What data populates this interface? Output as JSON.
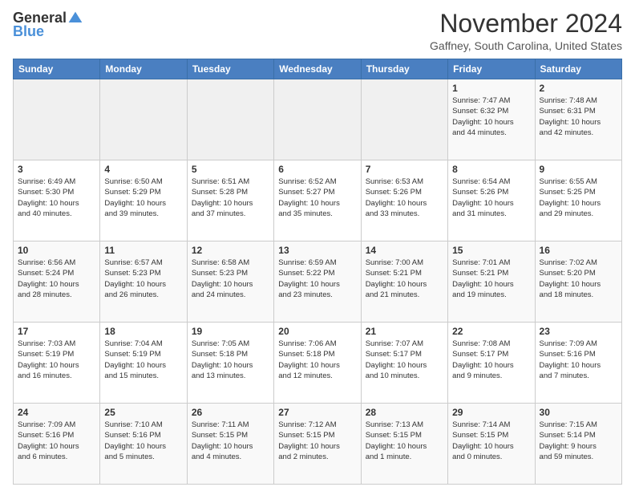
{
  "logo": {
    "general": "General",
    "blue": "Blue"
  },
  "header": {
    "title": "November 2024",
    "location": "Gaffney, South Carolina, United States"
  },
  "days_of_week": [
    "Sunday",
    "Monday",
    "Tuesday",
    "Wednesday",
    "Thursday",
    "Friday",
    "Saturday"
  ],
  "weeks": [
    [
      {
        "day": "",
        "info": ""
      },
      {
        "day": "",
        "info": ""
      },
      {
        "day": "",
        "info": ""
      },
      {
        "day": "",
        "info": ""
      },
      {
        "day": "",
        "info": ""
      },
      {
        "day": "1",
        "info": "Sunrise: 7:47 AM\nSunset: 6:32 PM\nDaylight: 10 hours\nand 44 minutes."
      },
      {
        "day": "2",
        "info": "Sunrise: 7:48 AM\nSunset: 6:31 PM\nDaylight: 10 hours\nand 42 minutes."
      }
    ],
    [
      {
        "day": "3",
        "info": "Sunrise: 6:49 AM\nSunset: 5:30 PM\nDaylight: 10 hours\nand 40 minutes."
      },
      {
        "day": "4",
        "info": "Sunrise: 6:50 AM\nSunset: 5:29 PM\nDaylight: 10 hours\nand 39 minutes."
      },
      {
        "day": "5",
        "info": "Sunrise: 6:51 AM\nSunset: 5:28 PM\nDaylight: 10 hours\nand 37 minutes."
      },
      {
        "day": "6",
        "info": "Sunrise: 6:52 AM\nSunset: 5:27 PM\nDaylight: 10 hours\nand 35 minutes."
      },
      {
        "day": "7",
        "info": "Sunrise: 6:53 AM\nSunset: 5:26 PM\nDaylight: 10 hours\nand 33 minutes."
      },
      {
        "day": "8",
        "info": "Sunrise: 6:54 AM\nSunset: 5:26 PM\nDaylight: 10 hours\nand 31 minutes."
      },
      {
        "day": "9",
        "info": "Sunrise: 6:55 AM\nSunset: 5:25 PM\nDaylight: 10 hours\nand 29 minutes."
      }
    ],
    [
      {
        "day": "10",
        "info": "Sunrise: 6:56 AM\nSunset: 5:24 PM\nDaylight: 10 hours\nand 28 minutes."
      },
      {
        "day": "11",
        "info": "Sunrise: 6:57 AM\nSunset: 5:23 PM\nDaylight: 10 hours\nand 26 minutes."
      },
      {
        "day": "12",
        "info": "Sunrise: 6:58 AM\nSunset: 5:23 PM\nDaylight: 10 hours\nand 24 minutes."
      },
      {
        "day": "13",
        "info": "Sunrise: 6:59 AM\nSunset: 5:22 PM\nDaylight: 10 hours\nand 23 minutes."
      },
      {
        "day": "14",
        "info": "Sunrise: 7:00 AM\nSunset: 5:21 PM\nDaylight: 10 hours\nand 21 minutes."
      },
      {
        "day": "15",
        "info": "Sunrise: 7:01 AM\nSunset: 5:21 PM\nDaylight: 10 hours\nand 19 minutes."
      },
      {
        "day": "16",
        "info": "Sunrise: 7:02 AM\nSunset: 5:20 PM\nDaylight: 10 hours\nand 18 minutes."
      }
    ],
    [
      {
        "day": "17",
        "info": "Sunrise: 7:03 AM\nSunset: 5:19 PM\nDaylight: 10 hours\nand 16 minutes."
      },
      {
        "day": "18",
        "info": "Sunrise: 7:04 AM\nSunset: 5:19 PM\nDaylight: 10 hours\nand 15 minutes."
      },
      {
        "day": "19",
        "info": "Sunrise: 7:05 AM\nSunset: 5:18 PM\nDaylight: 10 hours\nand 13 minutes."
      },
      {
        "day": "20",
        "info": "Sunrise: 7:06 AM\nSunset: 5:18 PM\nDaylight: 10 hours\nand 12 minutes."
      },
      {
        "day": "21",
        "info": "Sunrise: 7:07 AM\nSunset: 5:17 PM\nDaylight: 10 hours\nand 10 minutes."
      },
      {
        "day": "22",
        "info": "Sunrise: 7:08 AM\nSunset: 5:17 PM\nDaylight: 10 hours\nand 9 minutes."
      },
      {
        "day": "23",
        "info": "Sunrise: 7:09 AM\nSunset: 5:16 PM\nDaylight: 10 hours\nand 7 minutes."
      }
    ],
    [
      {
        "day": "24",
        "info": "Sunrise: 7:09 AM\nSunset: 5:16 PM\nDaylight: 10 hours\nand 6 minutes."
      },
      {
        "day": "25",
        "info": "Sunrise: 7:10 AM\nSunset: 5:16 PM\nDaylight: 10 hours\nand 5 minutes."
      },
      {
        "day": "26",
        "info": "Sunrise: 7:11 AM\nSunset: 5:15 PM\nDaylight: 10 hours\nand 4 minutes."
      },
      {
        "day": "27",
        "info": "Sunrise: 7:12 AM\nSunset: 5:15 PM\nDaylight: 10 hours\nand 2 minutes."
      },
      {
        "day": "28",
        "info": "Sunrise: 7:13 AM\nSunset: 5:15 PM\nDaylight: 10 hours\nand 1 minute."
      },
      {
        "day": "29",
        "info": "Sunrise: 7:14 AM\nSunset: 5:15 PM\nDaylight: 10 hours\nand 0 minutes."
      },
      {
        "day": "30",
        "info": "Sunrise: 7:15 AM\nSunset: 5:14 PM\nDaylight: 9 hours\nand 59 minutes."
      }
    ]
  ]
}
